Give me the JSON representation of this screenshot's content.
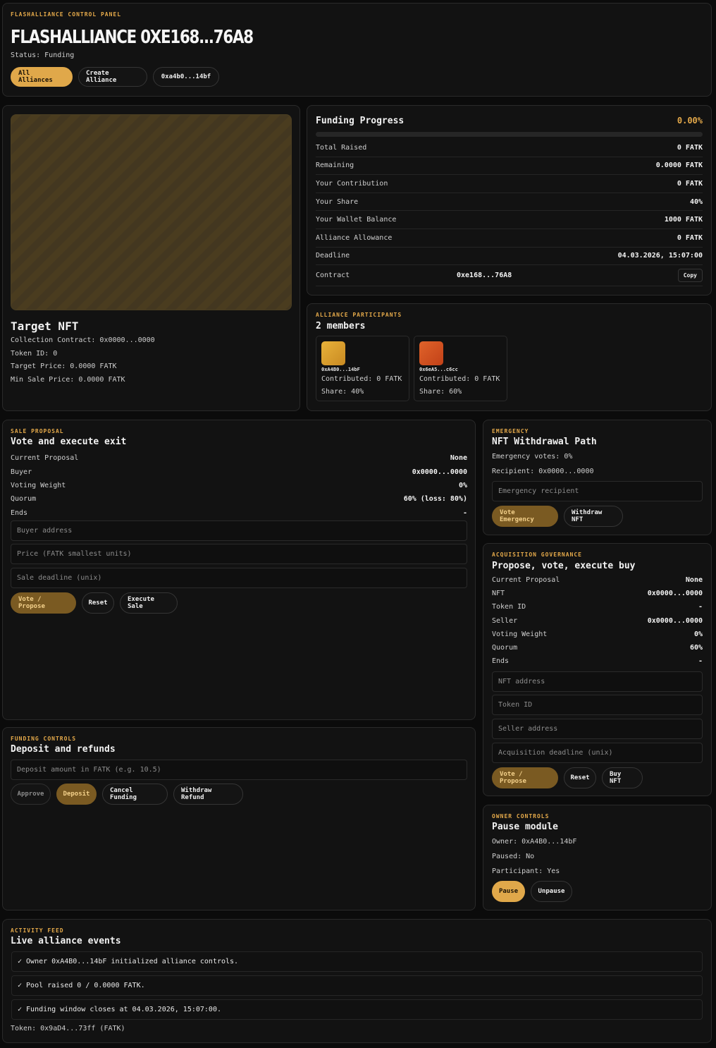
{
  "header": {
    "eyebrow": "FLASHALLIANCE CONTROL PANEL",
    "title": "FLASHALLIANCE 0XE168...76A8",
    "status": "Status: Funding",
    "buttons": [
      "All Alliances",
      "Create Alliance",
      "0xa4b0...14bf"
    ]
  },
  "nft": {
    "title": "Target NFT",
    "collection": "Collection Contract: 0x0000...0000",
    "token_id": "Token ID: 0",
    "target_price": "Target Price: 0.0000 FATK",
    "min_sale": "Min Sale Price: 0.0000 FATK"
  },
  "funding": {
    "title": "Funding Progress",
    "percent_label": "0.00%",
    "progress": 0,
    "rows": [
      {
        "label": "Total Raised",
        "value": "0 FATK"
      },
      {
        "label": "Remaining",
        "value": "0.0000 FATK"
      },
      {
        "label": "Your Contribution",
        "value": "0 FATK"
      },
      {
        "label": "Your Share",
        "value": "40%"
      },
      {
        "label": "Your Wallet Balance",
        "value": "1000 FATK"
      },
      {
        "label": "Alliance Allowance",
        "value": "0 FATK"
      },
      {
        "label": "Deadline",
        "value": "04.03.2026, 15:07:00"
      }
    ],
    "contract_label": "Contract",
    "contract_value": "0xe168...76A8",
    "copy_label": "Copy"
  },
  "participants": {
    "eyebrow": "ALLIANCE PARTICIPANTS",
    "title": "2 members",
    "members": [
      {
        "address": "0xA4B0...14bF",
        "contributed": "Contributed: 0 FATK",
        "share": "Share: 40%",
        "color_a": "#e8b23a",
        "color_b": "#c98a22"
      },
      {
        "address": "0x6eA5...c6cc",
        "contributed": "Contributed: 0 FATK",
        "share": "Share: 60%",
        "color_a": "#e0632a",
        "color_b": "#c24118"
      }
    ]
  },
  "sale": {
    "eyebrow": "SALE PROPOSAL",
    "title": "Vote and execute exit",
    "rows": [
      {
        "label": "Current Proposal",
        "value": "None"
      },
      {
        "label": "Buyer",
        "value": "0x0000...0000"
      },
      {
        "label": "Voting Weight",
        "value": "0%"
      },
      {
        "label": "Quorum",
        "value": "60% (loss: 80%)"
      },
      {
        "label": "Ends",
        "value": "-"
      }
    ],
    "placeholders": [
      "Buyer address",
      "Price (FATK smallest units)",
      "Sale deadline (unix)"
    ],
    "buttons": [
      "Vote / Propose",
      "Reset",
      "Execute Sale"
    ]
  },
  "emergency": {
    "eyebrow": "EMERGENCY",
    "title": "NFT Withdrawal Path",
    "votes": "Emergency votes: 0%",
    "recipient": "Recipient: 0x0000...0000",
    "placeholder": "Emergency recipient",
    "buttons": [
      "Vote Emergency",
      "Withdraw NFT"
    ]
  },
  "acquisition": {
    "eyebrow": "ACQUISITION GOVERNANCE",
    "title": "Propose, vote, execute buy",
    "rows": [
      {
        "label": "Current Proposal",
        "value": "None"
      },
      {
        "label": "NFT",
        "value": "0x0000...0000"
      },
      {
        "label": "Token ID",
        "value": "-"
      },
      {
        "label": "Seller",
        "value": "0x0000...0000"
      },
      {
        "label": "Voting Weight",
        "value": "0%"
      },
      {
        "label": "Quorum",
        "value": "60%"
      },
      {
        "label": "Ends",
        "value": "-"
      }
    ],
    "placeholders": [
      "NFT address",
      "Token ID",
      "Seller address",
      "Acquisition deadline (unix)"
    ],
    "buttons": [
      "Vote / Propose",
      "Reset",
      "Buy NFT"
    ]
  },
  "funding_controls": {
    "eyebrow": "FUNDING CONTROLS",
    "title": "Deposit and refunds",
    "placeholder": "Deposit amount in FATK (e.g. 10.5)",
    "buttons": [
      "Approve",
      "Deposit",
      "Cancel Funding",
      "Withdraw Refund"
    ]
  },
  "owner": {
    "eyebrow": "OWNER CONTROLS",
    "title": "Pause module",
    "owner": "Owner: 0xA4B0...14bF",
    "paused": "Paused: No",
    "participant": "Participant: Yes",
    "buttons": [
      "Pause",
      "Unpause"
    ]
  },
  "activity": {
    "eyebrow": "ACTIVITY FEED",
    "title": "Live alliance events",
    "events": [
      "✓ Owner 0xA4B0...14bF initialized alliance controls.",
      "✓ Pool raised 0 / 0.0000 FATK.",
      "✓ Funding window closes at 04.03.2026, 15:07:00."
    ],
    "token": "Token: 0x9aD4...73ff (FATK)"
  },
  "colors": {
    "accent": "#e0a84a",
    "accent_dark": "#7a5a22",
    "background": "#0b0b0b",
    "card": "#121212"
  }
}
